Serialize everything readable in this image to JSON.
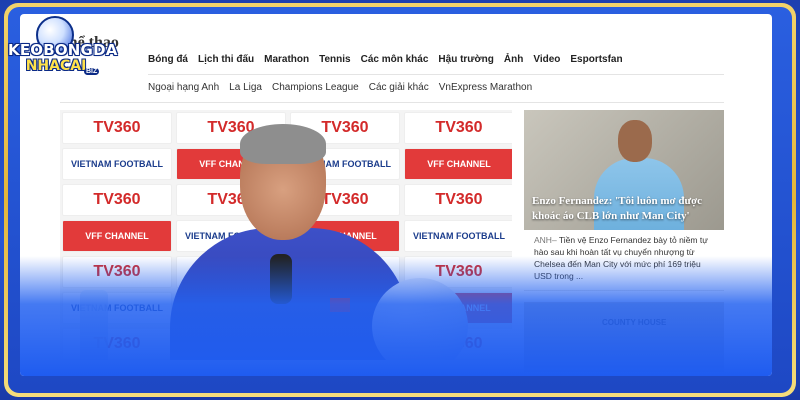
{
  "site": {
    "name": "Thể thao",
    "logo_line1": "KEOBONGDA",
    "logo_line2": "NHACAI",
    "logo_suffix": "BIZ"
  },
  "nav_primary": [
    {
      "label": "Bóng đá"
    },
    {
      "label": "Lịch thi đấu"
    },
    {
      "label": "Marathon"
    },
    {
      "label": "Tennis"
    },
    {
      "label": "Các môn khác"
    },
    {
      "label": "Hậu trường"
    },
    {
      "label": "Ảnh"
    },
    {
      "label": "Video"
    },
    {
      "label": "Esportsfan"
    }
  ],
  "nav_secondary": [
    {
      "label": "Ngoại hạng Anh"
    },
    {
      "label": "La Liga"
    },
    {
      "label": "Champions League"
    },
    {
      "label": "Các giải khác"
    },
    {
      "label": "VnExpress Marathon"
    }
  ],
  "hero": {
    "backdrop_brand": "TV360",
    "backdrop_small": "VIETNAM FOOTBALL",
    "backdrop_red": "VFF CHANNEL"
  },
  "side_article": {
    "headline": "Enzo Fernandez: 'Tôi luôn mơ được khoác áo CLB lớn như Man City'",
    "source": "ANH–",
    "summary": "Tiền vệ Enzo Fernandez bày tỏ niềm tự hào sau khi hoàn tất vụ chuyển nhượng từ Chelsea đến Man City với mức phí 169 triệu USD trong ..."
  },
  "side_article2": {
    "sign_text": "COUNTY HOUSE"
  },
  "colors": {
    "frame_gold": "#e3b53a",
    "frame_blue": "#2a5fe0",
    "brand_red": "#d32a2a"
  }
}
